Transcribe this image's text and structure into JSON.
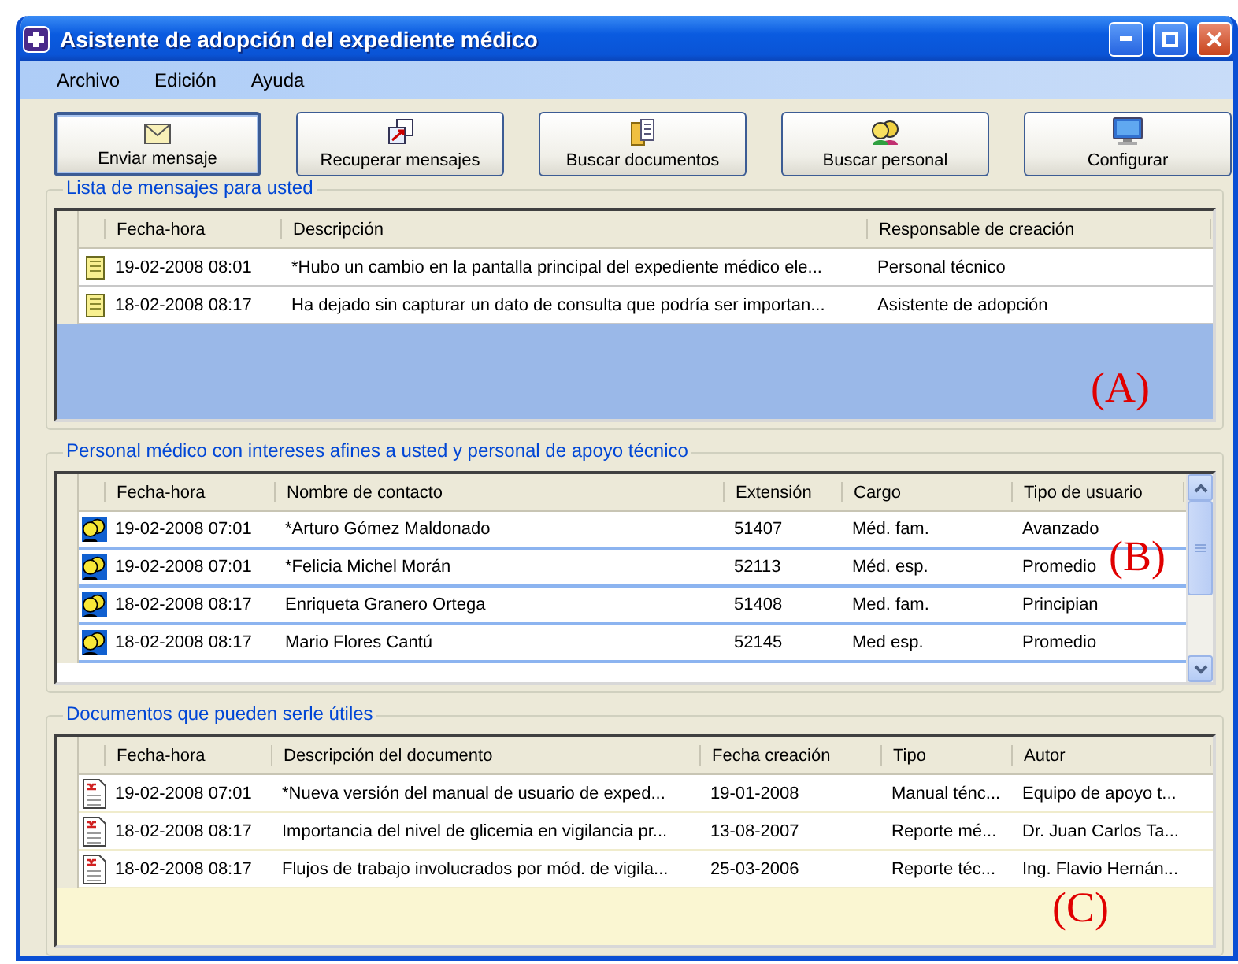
{
  "window": {
    "title": "Asistente de adopción del expediente médico"
  },
  "menu": [
    "Archivo",
    "Edición",
    "Ayuda"
  ],
  "toolbar": [
    {
      "kind": "send",
      "label": "Enviar mensaje",
      "selected": true
    },
    {
      "kind": "retrieve",
      "label": "Recuperar mensajes",
      "selected": false
    },
    {
      "kind": "documents",
      "label": "Buscar documentos",
      "selected": false
    },
    {
      "kind": "people",
      "label": "Buscar personal",
      "selected": false
    },
    {
      "kind": "settings",
      "label": "Configurar",
      "selected": false
    }
  ],
  "sections": [
    {
      "kind": "messages",
      "legend": "Lista de mensajes para usted",
      "annotation": "(A)",
      "columns": [
        "Fecha-hora",
        "Descripción",
        "Responsable de creación"
      ],
      "rows": [
        [
          "19-02-2008 08:01",
          "*Hubo un cambio en la pantalla principal del expediente médico ele...",
          "Personal técnico"
        ],
        [
          "18-02-2008 08:17",
          "Ha dejado sin capturar un dato de consulta que podría ser importan...",
          "Asistente de adopción"
        ]
      ]
    },
    {
      "kind": "staff",
      "legend": "Personal médico con intereses afines a usted y personal de apoyo técnico",
      "annotation": "(B)",
      "columns": [
        "Fecha-hora",
        "Nombre de contacto",
        "Extensión",
        "Cargo",
        "Tipo de usuario"
      ],
      "rows": [
        [
          "19-02-2008 07:01",
          "*Arturo Gómez Maldonado",
          "51407",
          "Méd. fam.",
          "Avanzado"
        ],
        [
          "19-02-2008 07:01",
          "*Felicia Michel Morán",
          "52113",
          "Méd. esp.",
          "Promedio"
        ],
        [
          "18-02-2008 08:17",
          "Enriqueta Granero Ortega",
          "51408",
          "Med. fam.",
          "Principian"
        ],
        [
          "18-02-2008 08:17",
          "Mario Flores Cantú",
          "52145",
          "Med esp.",
          "Promedio"
        ]
      ]
    },
    {
      "kind": "documents",
      "legend": "Documentos que pueden serle útiles",
      "annotation": "(C)",
      "columns": [
        "Fecha-hora",
        "Descripción del documento",
        "Fecha creación",
        "Tipo",
        "Autor"
      ],
      "rows": [
        [
          "19-02-2008 07:01",
          "*Nueva versión del manual de usuario  de exped...",
          "19-01-2008",
          "Manual ténc...",
          "Equipo de apoyo t..."
        ],
        [
          "18-02-2008 08:17",
          "Importancia del nivel de glicemia en vigilancia pr...",
          "13-08-2007",
          "Reporte mé...",
          "Dr. Juan Carlos Ta..."
        ],
        [
          "18-02-2008 08:17",
          "Flujos de trabajo involucrados por mód. de vigila...",
          "25-03-2006",
          "Reporte téc...",
          "Ing. Flavio Hernán..."
        ]
      ]
    }
  ]
}
